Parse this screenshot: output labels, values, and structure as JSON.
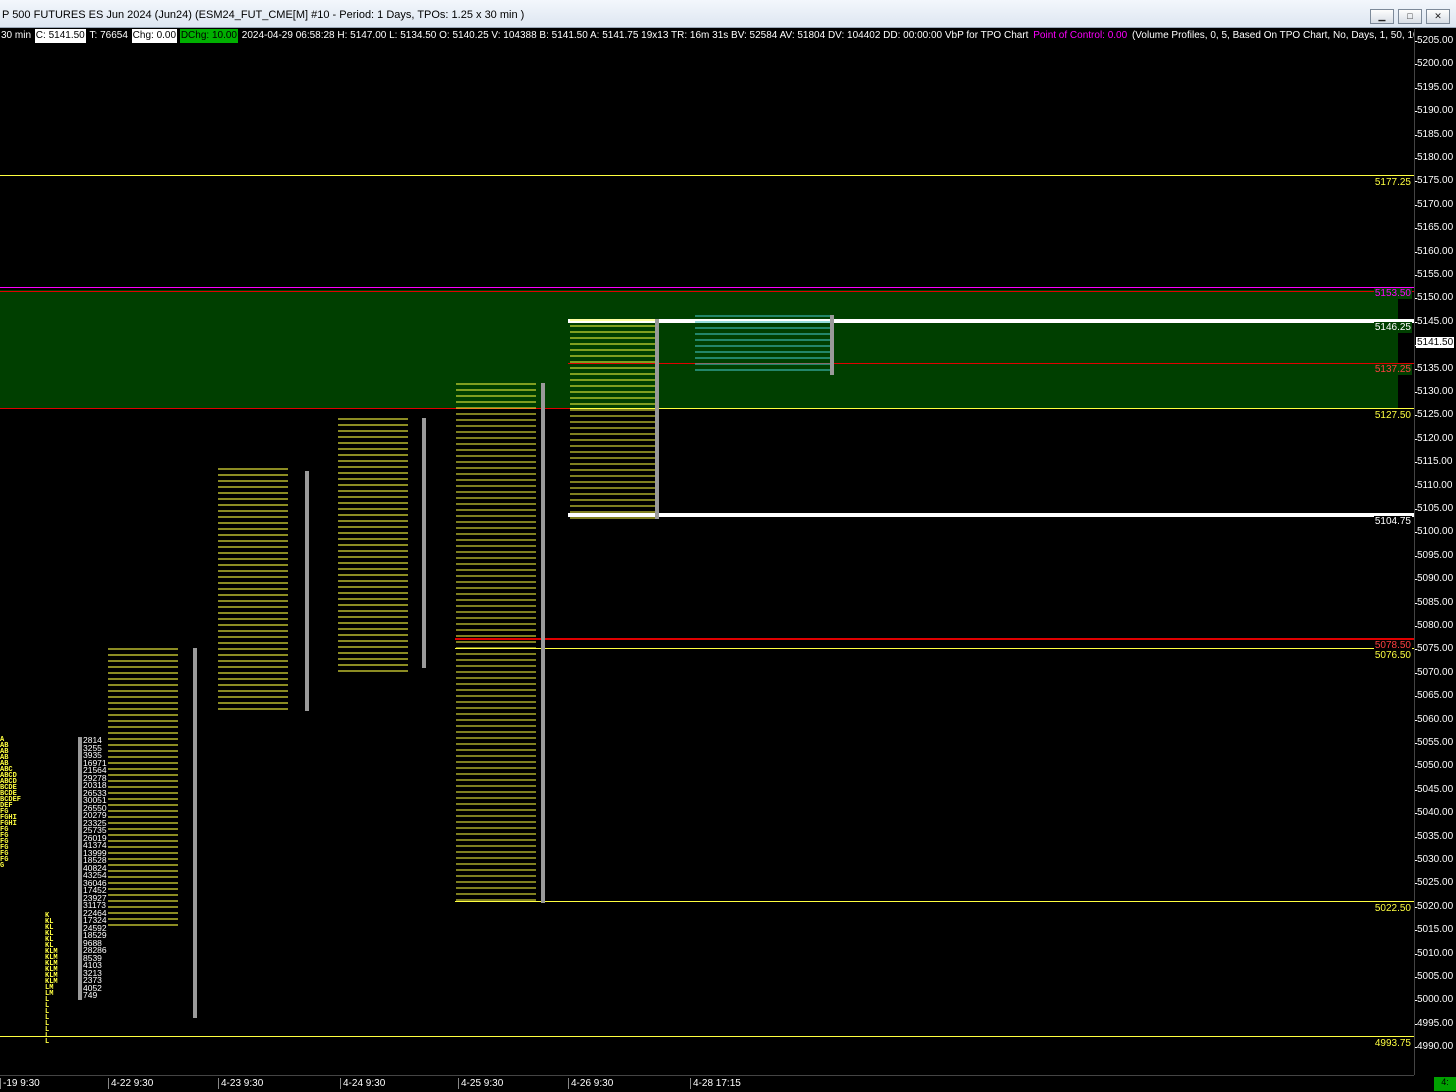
{
  "window": {
    "title": "P 500 FUTURES ES Jun 2024 (Jun24) (ESM24_FUT_CME[M]  #10 - Period: 1 Days, TPOs: 1.25 x 30 min  )",
    "minimize_label": "▁",
    "maximize_label": "□",
    "close_label": "✕"
  },
  "infobar": {
    "interval": "30 min",
    "close": "C: 5141.50",
    "ticks": "T: 76654",
    "chg": "Chg: 0.00",
    "dchg": "DChg: 10.00",
    "details": "2024-04-29 06:58:28 H: 5147.00 L: 5134.50 O: 5140.25 V: 104388 B: 5141.50 A: 5141.75 19x13 TR: 16m 31s BV: 52584 AV: 51804 DV: 104402 DD: 00:00:00 VbP for TPO Chart",
    "poc": "Point of Control: 0.00",
    "study": "(Volume Profiles, 0, 5, Based On TPO Chart, No, Days, 1, 50, 1000000"
  },
  "colors": {
    "value_area": "#003f00",
    "poc_line": "#ff00ff",
    "red_level": "#e00000",
    "yellow_level": "#ffff40",
    "white_level": "#ffffff"
  },
  "price_axis": {
    "ticks": [
      "5205.00",
      "5200.00",
      "5195.00",
      "5190.00",
      "5185.00",
      "5180.00",
      "5175.00",
      "5170.00",
      "5165.00",
      "5160.00",
      "5155.00",
      "5150.00",
      "5145.00",
      "5140.00",
      "5135.00",
      "5130.00",
      "5125.00",
      "5120.00",
      "5115.00",
      "5110.00",
      "5105.00",
      "5100.00",
      "5095.00",
      "5090.00",
      "5085.00",
      "5080.00",
      "5075.00",
      "5070.00",
      "5065.00",
      "5060.00",
      "5055.00",
      "5050.00",
      "5045.00",
      "5040.00",
      "5035.00",
      "5030.00",
      "5025.00",
      "5020.00",
      "5015.00",
      "5010.00",
      "5005.00",
      "5000.00",
      "4995.00",
      "4990.00"
    ],
    "current_price": "5141.50"
  },
  "levels": {
    "l5177": "5177.25",
    "l5153": "5153.50",
    "l5146": "5146.25",
    "l5137": "5137.25",
    "l5127": "5127.50",
    "l5104": "5104.75",
    "l5078": "5078.50",
    "l5076": "5076.50",
    "l5022": "5022.50",
    "l4993": "4993.75"
  },
  "time_axis": {
    "labels": [
      "-19  9:30",
      "4-22  9:30",
      "4-23  9:30",
      "4-24  9:30",
      "4-25  9:30",
      "4-26  9:30",
      "4-28  17:15"
    ],
    "corner": "4:"
  },
  "profiles": [
    {
      "tpo": "A\nAB\nAB\nAB\nAB\nABC\nABCD\nABCD\nBCDE\nBCDE\nBCDEF\nDEF\nFG\nFGHI\nFGHI\nFG\nFG\nFG\nFG\nFG\nFG\nG",
      "color": "#ffff40"
    },
    {
      "vol": "2814\n3255\n3935\n16971\n21564\n29278\n20318\n26533\n30051\n26550\n20279\n23325\n25735\n26019\n41374\n13999\n18528\n40824\n43254\n36046\n17452\n23927\n31173\n22464\n17324\n24592\n18529\n9688\n28286\n8539\n4103\n3213\n2373\n4052\n749"
    },
    {
      "tpo": "K\nKL\nKL\nKL\nKL\nKL\nKLM\nKLM\nKLM\nKLM\nKLM\nKLM\nLM\nLM\nL\nL\nL\nL\nL\nL\nL\nL",
      "color": "#ffff40"
    }
  ]
}
